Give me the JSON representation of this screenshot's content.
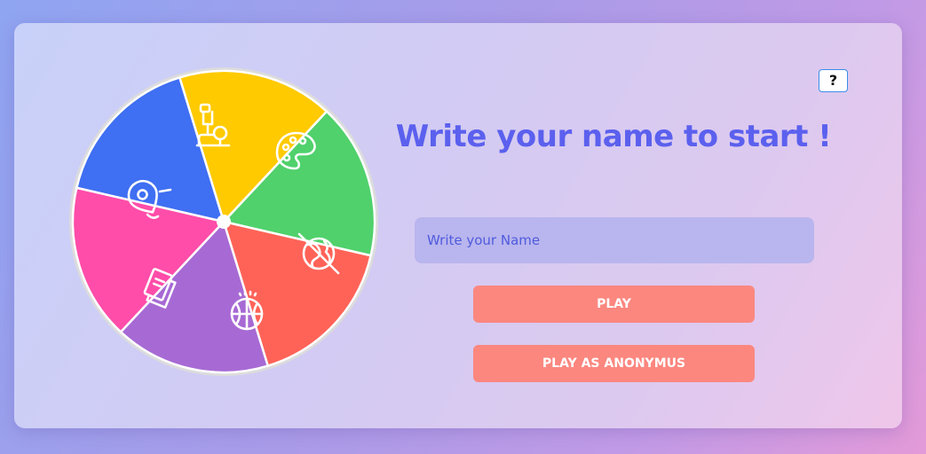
{
  "title": "Write your name to start !",
  "help_button": {
    "label": "?"
  },
  "name_input": {
    "placeholder": "Write your Name",
    "value": ""
  },
  "play_button": {
    "label": "PLAY"
  },
  "play_anonymous_button": {
    "label": "PLAY AS ANONYMUS"
  },
  "wheel": {
    "segments": [
      {
        "category": "science",
        "icon": "microscope-icon",
        "color": "#ffca00"
      },
      {
        "category": "art",
        "icon": "palette-icon",
        "color": "#50d16c"
      },
      {
        "category": "history",
        "icon": "broken-globe-icon",
        "color": "#ff6358"
      },
      {
        "category": "sports",
        "icon": "basketball-icon",
        "color": "#a76ad4"
      },
      {
        "category": "entertainment",
        "icon": "books-icon",
        "color": "#ff4da9"
      },
      {
        "category": "geography",
        "icon": "map-pin-icon",
        "color": "#3f6ff2"
      }
    ],
    "rim_color": "#dcdcdc"
  }
}
